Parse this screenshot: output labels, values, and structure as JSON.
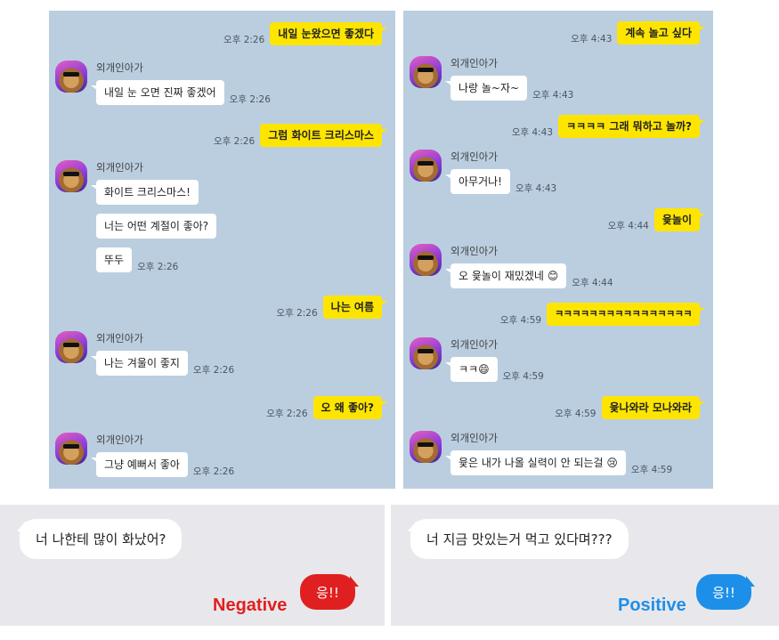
{
  "colors": {
    "chat_bg": "#bacee0",
    "my_bubble": "#fee500",
    "other_bubble": "#ffffff",
    "negative": "#e02020",
    "positive": "#1e8fe8",
    "bottom_bg": "#e8e8ec"
  },
  "icons": {
    "avatar": "dog-with-sunglasses-avatar",
    "smile_emoji": "smile-emoji",
    "grin_emoji": "grin-emoji",
    "tear_emoji": "tear-emoji"
  },
  "left_chat": {
    "m1": {
      "text": "내일 눈왔으면 좋겠다",
      "time": "오후 2:26"
    },
    "g1": {
      "sender": "외개인아가",
      "msgs": [
        {
          "text": "내일 눈 오면 진짜 좋겠어",
          "time": "오후 2:26"
        }
      ]
    },
    "m2": {
      "text": "그럼 화이트 크리스마스",
      "time": "오후 2:26"
    },
    "g2": {
      "sender": "외개인아가",
      "msgs": [
        {
          "text": "화이트 크리스마스!",
          "time": ""
        },
        {
          "text": "너는 어떤 계절이 좋아?",
          "time": ""
        },
        {
          "text": "뚜두",
          "time": "오후 2:26"
        }
      ]
    },
    "m3": {
      "text": "나는 여름",
      "time": "오후 2:26"
    },
    "g3": {
      "sender": "외개인아가",
      "msgs": [
        {
          "text": "나는 겨울이 좋지",
          "time": "오후 2:26"
        }
      ]
    },
    "m4": {
      "text": "오 왜 좋아?",
      "time": "오후 2:26"
    },
    "g4": {
      "sender": "외개인아가",
      "msgs": [
        {
          "text": "그냥 예뻐서 좋아",
          "time": "오후 2:26"
        }
      ]
    }
  },
  "right_chat": {
    "m1": {
      "text": "계속 놀고 싶다",
      "time": "오후 4:43"
    },
    "g1": {
      "sender": "외개인아가",
      "msgs": [
        {
          "text": "나랑 놀~자~",
          "time": "오후 4:43"
        }
      ]
    },
    "m2": {
      "text": "ㅋㅋㅋㅋ 그래 뭐하고 놀까?",
      "time": "오후 4:43"
    },
    "g2": {
      "sender": "외개인아가",
      "msgs": [
        {
          "text": "아무거나!",
          "time": "오후 4:43"
        }
      ]
    },
    "m3": {
      "text": "윷놀이",
      "time": "오후 4:44"
    },
    "g3": {
      "sender": "외개인아가",
      "msgs": [
        {
          "text": "오 윷놀이 재밌겠네 😊",
          "time": "오후 4:44"
        }
      ]
    },
    "m4": {
      "text": "ㅋㅋㅋㅋㅋㅋㅋㅋㅋㅋㅋㅋㅋㅋㅋㅋ",
      "time": "오후 4:59"
    },
    "g4": {
      "sender": "외개인아가",
      "msgs": [
        {
          "text": "ㅋㅋ😄",
          "time": "오후 4:59"
        }
      ]
    },
    "m5": {
      "text": "윷나와라 모나와라",
      "time": "오후 4:59"
    },
    "g5": {
      "sender": "외개인아가",
      "msgs": [
        {
          "text": "윷은 내가 나올 실력이 안 되는걸 😢",
          "time": "오후 4:59"
        }
      ]
    }
  },
  "bottom_left": {
    "question": "너 나한테 많이 화났어?",
    "label": "Negative",
    "answer": "응!!"
  },
  "bottom_right": {
    "question": "너 지금 맛있는거 먹고 있다며???",
    "label": "Positive",
    "answer": "응!!"
  }
}
